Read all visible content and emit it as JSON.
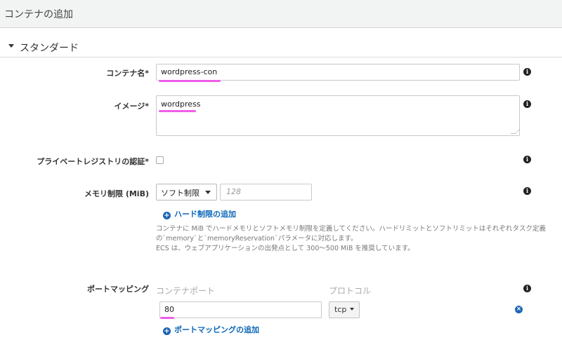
{
  "header": {
    "title": "コンテナの追加"
  },
  "section": {
    "title": "スタンダード"
  },
  "container_name": {
    "label": "コンテナ名*",
    "value": "wordpress-con"
  },
  "image": {
    "label": "イメージ*",
    "value": "wordpress"
  },
  "private_registry": {
    "label": "プライベートレジストリの認証*",
    "checked": false
  },
  "memory": {
    "label": "メモリ制限 (MiB)",
    "select_value": "ソフト制限",
    "placeholder": "128",
    "add_hard_limit": "ハード制限の追加",
    "help_lines": [
      "コンテナに MiB でハードメモリとソフトメモリ制限を定義してください。ハードリミットとソフトリミットはそれぞれタスク定義",
      "の`memory`と`memoryReservation`パラメータに対応します。",
      "ECS は、ウェブアプリケーションの出発点として 300～500 MiB を推奨しています。"
    ]
  },
  "port_mapping": {
    "label": "ポートマッピング",
    "col_container_port": "コンテナポート",
    "col_protocol": "プロトコル",
    "container_port_value": "80",
    "protocol_value": "tcp",
    "add_label": "ポートマッピングの追加"
  },
  "icons": {
    "info": "info-icon",
    "add": "plus-circle-icon",
    "remove": "remove-circle-icon",
    "caret": "caret-down-icon"
  },
  "colors": {
    "highlight": "#ee5ee9",
    "link": "#0b66b8"
  }
}
